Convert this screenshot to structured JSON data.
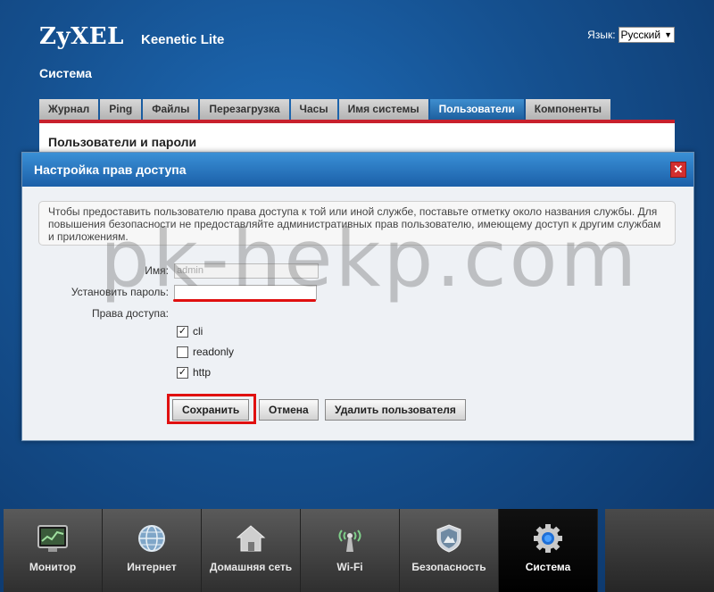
{
  "brand": {
    "logo": "ZyXEL",
    "model": "Keenetic Lite"
  },
  "language": {
    "label": "Язык:",
    "selected": "Русский"
  },
  "section_title": "Система",
  "tabs": [
    {
      "label": "Журнал",
      "active": false
    },
    {
      "label": "Ping",
      "active": false
    },
    {
      "label": "Файлы",
      "active": false
    },
    {
      "label": "Перезагрузка",
      "active": false
    },
    {
      "label": "Часы",
      "active": false
    },
    {
      "label": "Имя системы",
      "active": false
    },
    {
      "label": "Пользователи",
      "active": true
    },
    {
      "label": "Компоненты",
      "active": false
    }
  ],
  "panel_title": "Пользователи и пароли",
  "dialog": {
    "title": "Настройка прав доступа",
    "info_text": "Чтобы предоставить пользователю права доступа к той или иной службе, поставьте отметку около названия службы. Для повышения безопасности не предоставляйте административных прав пользователю, имеющему доступ к другим службам и приложениям.",
    "name_label": "Имя:",
    "name_value": "admin",
    "password_label": "Установить пароль:",
    "password_value": "",
    "access_label": "Права доступа:",
    "permissions": [
      {
        "label": "cli",
        "checked": true
      },
      {
        "label": "readonly",
        "checked": false
      },
      {
        "label": "http",
        "checked": true
      }
    ],
    "save_label": "Сохранить",
    "cancel_label": "Отмена",
    "delete_label": "Удалить пользователя"
  },
  "watermark": "pk-hekp.com",
  "bottom_nav": [
    {
      "label": "Монитор",
      "icon": "monitor-icon",
      "active": false
    },
    {
      "label": "Интернет",
      "icon": "globe-icon",
      "active": false
    },
    {
      "label": "Домашняя сеть",
      "icon": "home-icon",
      "active": false
    },
    {
      "label": "Wi-Fi",
      "icon": "wifi-antenna-icon",
      "active": false
    },
    {
      "label": "Безопасность",
      "icon": "shield-icon",
      "active": false
    },
    {
      "label": "Система",
      "icon": "gear-icon",
      "active": true
    }
  ],
  "colors": {
    "accent_red": "#e01010",
    "header_blue": "#1b5fa8",
    "tab_active": "#1d5f9e"
  }
}
